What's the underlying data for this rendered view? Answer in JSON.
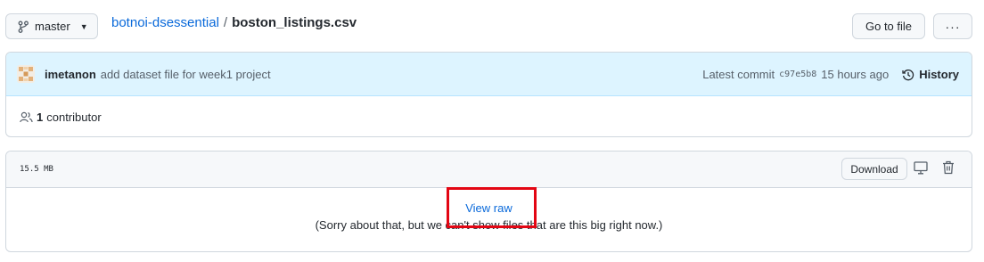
{
  "branch": {
    "name": "master"
  },
  "breadcrumb": {
    "repo": "botnoi-dsessential",
    "separator": "/",
    "file": "boston_listings.csv"
  },
  "toolbar": {
    "go_to_file": "Go to file",
    "more": "···"
  },
  "commit": {
    "author": "imetanon",
    "message": "add dataset file for week1 project",
    "latest_label": "Latest commit",
    "sha": "c97e5b8",
    "time": "15 hours ago",
    "history_label": "History"
  },
  "contributors": {
    "count": "1",
    "label": "contributor"
  },
  "file": {
    "size": "15.5 MB",
    "download_label": "Download",
    "view_raw": "View raw",
    "too_big_message": "(Sorry about that, but we can't show files that are this big right now.)"
  },
  "colors": {
    "link": "#0969da",
    "highlight": "#e30613",
    "commit_bg": "#ddf4ff"
  }
}
